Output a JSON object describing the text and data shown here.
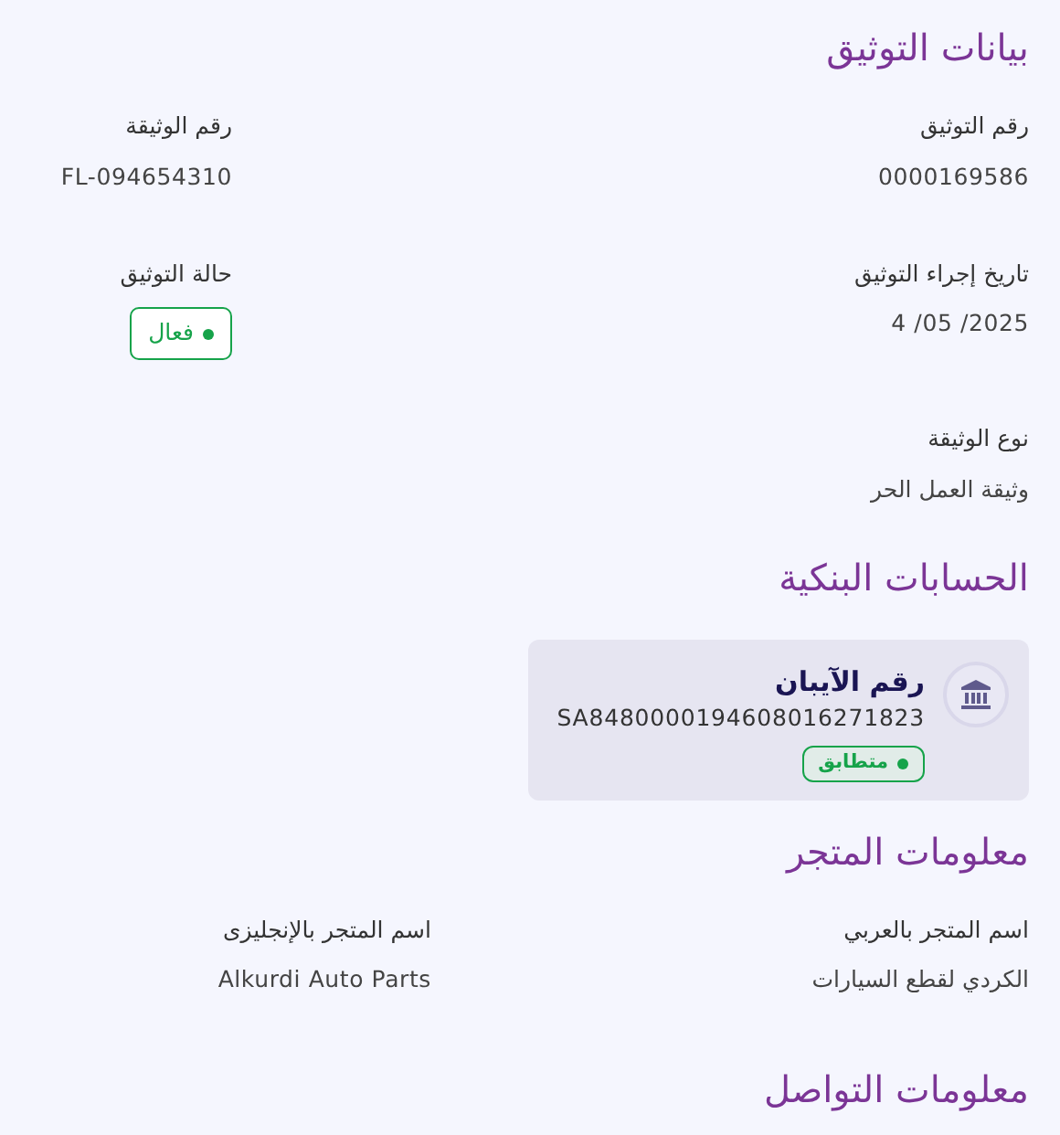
{
  "sections": [
    {
      "kind": "details",
      "title": "بيانات التوثيق",
      "fields": [
        {
          "kind": "text",
          "label": "رقم التوثيق",
          "value": "0000169586"
        },
        {
          "kind": "text",
          "label": "رقم الوثيقة",
          "value": "FL-094654310"
        },
        {
          "kind": "date",
          "label": "تاريخ إجراء التوثيق",
          "value": "4 /05 /2025"
        },
        {
          "kind": "status",
          "label": "حالة التوثيق",
          "value": "فعال",
          "color": "#16a34a"
        },
        {
          "kind": "text",
          "label": "نوع الوثيقة",
          "value": "وثيقة العمل الحر"
        }
      ]
    },
    {
      "kind": "accounts",
      "title": "الحسابات البنكية",
      "accounts": [
        {
          "label": "رقم الآيبان",
          "iban": "SA8480000194608016271823",
          "status": "متطابق",
          "color": "#16a34a"
        }
      ]
    },
    {
      "kind": "info",
      "title": "معلومات المتجر",
      "fields": [
        {
          "kind": "text",
          "label": "اسم المتجر بالعربي",
          "value": "الكردي لقطع السيارات"
        },
        {
          "kind": "text",
          "label": "اسم المتجر بالإنجليزى",
          "value": "Alkurdi Auto Parts"
        }
      ]
    },
    {
      "kind": "info",
      "title": "معلومات التواصل"
    }
  ]
}
